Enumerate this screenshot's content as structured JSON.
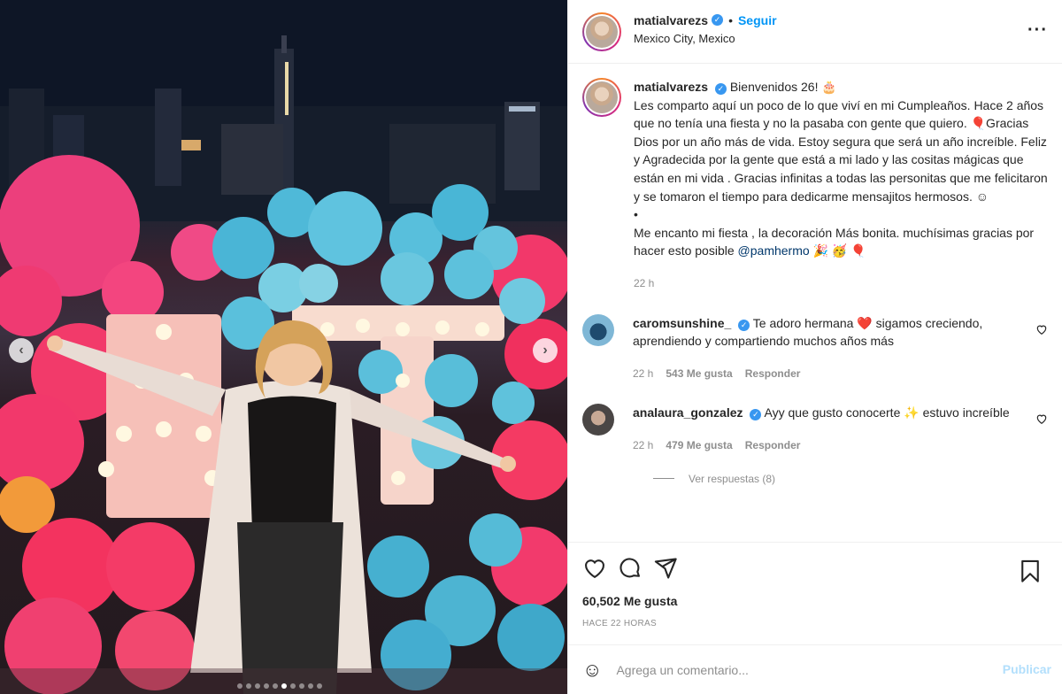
{
  "post": {
    "username": "matialvarezs",
    "verified_mark": "✓",
    "separator": "•",
    "follow_label": "Seguir",
    "location": "Mexico City, Mexico",
    "more_label": "···"
  },
  "caption": {
    "username": "matialvarezs",
    "text_1": "Bienvenidos 26! 🎂",
    "text_2": "Les comparto aquí un poco de lo que viví en mi Cumpleaños. Hace 2 años que no tenía una fiesta y no la pasaba con gente que quiero. 🎈Gracias Dios por un año más de vida. Estoy segura que será un año increíble. Feliz y Agradecida por la gente que está a mi lado y las cositas mágicas que están en mi vida . Gracias infinitas a todas las personitas que me felicitaron y se tomaron el tiempo para dedicarme mensajitos hermosos. ☺",
    "bullet": "•",
    "text_3": "Me encanto mi fiesta , la decoración Más bonita. muchísimas gracias por hacer esto posible ",
    "mention": "@pamhermo",
    "emoji_end": " 🎉 🥳 🎈",
    "time": "22 h"
  },
  "comments": [
    {
      "username": "caromsunshine_",
      "text": "Te adoro hermana ❤️ sigamos creciendo, aprendiendo y compartiendo muchos años más",
      "time": "22 h",
      "likes": "543 Me gusta",
      "reply": "Responder"
    },
    {
      "username": "analaura_gonzalez",
      "text": "Ayy que gusto conocerte ✨ estuvo increíble",
      "time": "22 h",
      "likes": "479 Me gusta",
      "reply": "Responder"
    }
  ],
  "view_replies": "Ver respuestas (8)",
  "likes_count": "60,502 Me gusta",
  "posted_ago": "HACE 22 HORAS",
  "comment_box": {
    "placeholder": "Agrega un comentario...",
    "publish_label": "Publicar",
    "emoji_icon": "☺"
  },
  "carousel": {
    "prev": "‹",
    "next": "›",
    "slide_count": 10,
    "active_slide": 6
  },
  "icons": {
    "like": "heart-icon",
    "comment": "comment-icon",
    "share": "share-icon",
    "save": "bookmark-icon"
  }
}
